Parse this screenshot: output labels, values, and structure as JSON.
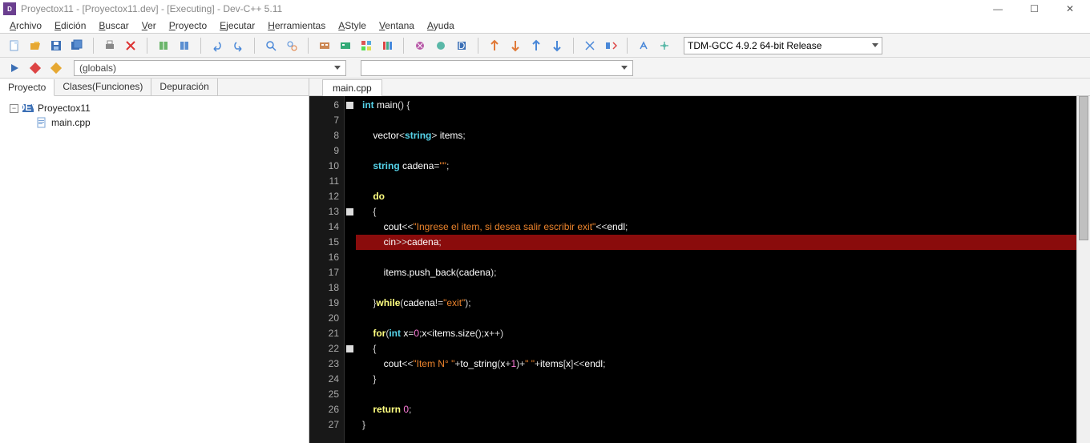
{
  "title": "Proyectox11 - [Proyectox11.dev] - [Executing] - Dev-C++ 5.11",
  "menu": [
    "Archivo",
    "Edición",
    "Buscar",
    "Ver",
    "Proyecto",
    "Ejecutar",
    "Herramientas",
    "AStyle",
    "Ventana",
    "Ayuda"
  ],
  "compiler": "TDM-GCC 4.9.2 64-bit Release",
  "globals": "(globals)",
  "left_tabs": [
    "Proyecto",
    "Clases(Funciones)",
    "Depuración"
  ],
  "project": {
    "name": "Proyectox11",
    "file": "main.cpp"
  },
  "file_tab": "main.cpp",
  "gutter_start": 6,
  "gutter_end": 27,
  "code_lines": [
    {
      "n": 6,
      "fold": true,
      "tokens": [
        {
          "t": "type",
          "v": "int"
        },
        {
          "t": "sp",
          "v": " "
        },
        {
          "t": "ident",
          "v": "main"
        },
        {
          "t": "punc",
          "v": "() {"
        }
      ]
    },
    {
      "n": 7,
      "tokens": []
    },
    {
      "n": 8,
      "tokens": [
        {
          "t": "sp",
          "v": "    "
        },
        {
          "t": "ident",
          "v": "vector"
        },
        {
          "t": "punc",
          "v": "<"
        },
        {
          "t": "type",
          "v": "string"
        },
        {
          "t": "punc",
          "v": "> "
        },
        {
          "t": "ident",
          "v": "items"
        },
        {
          "t": "punc",
          "v": ";"
        }
      ]
    },
    {
      "n": 9,
      "tokens": []
    },
    {
      "n": 10,
      "tokens": [
        {
          "t": "sp",
          "v": "    "
        },
        {
          "t": "type",
          "v": "string"
        },
        {
          "t": "sp",
          "v": " "
        },
        {
          "t": "ident",
          "v": "cadena"
        },
        {
          "t": "punc",
          "v": "="
        },
        {
          "t": "str",
          "v": "\"\""
        },
        {
          "t": "punc",
          "v": ";"
        }
      ]
    },
    {
      "n": 11,
      "tokens": []
    },
    {
      "n": 12,
      "tokens": [
        {
          "t": "sp",
          "v": "    "
        },
        {
          "t": "kw",
          "v": "do"
        }
      ]
    },
    {
      "n": 13,
      "fold": true,
      "tokens": [
        {
          "t": "sp",
          "v": "    "
        },
        {
          "t": "punc",
          "v": "{"
        }
      ]
    },
    {
      "n": 14,
      "tokens": [
        {
          "t": "sp",
          "v": "        "
        },
        {
          "t": "ident",
          "v": "cout"
        },
        {
          "t": "punc",
          "v": "<<"
        },
        {
          "t": "str",
          "v": "\"Ingrese el item, si desea salir escribir exit\""
        },
        {
          "t": "punc",
          "v": "<<"
        },
        {
          "t": "ident",
          "v": "endl"
        },
        {
          "t": "punc",
          "v": ";"
        }
      ]
    },
    {
      "n": 15,
      "hl": true,
      "tokens": [
        {
          "t": "sp",
          "v": "        "
        },
        {
          "t": "ident",
          "v": "cin"
        },
        {
          "t": "punc",
          "v": ">>"
        },
        {
          "t": "ident",
          "v": "cadena"
        },
        {
          "t": "punc",
          "v": ";"
        }
      ]
    },
    {
      "n": 16,
      "tokens": []
    },
    {
      "n": 17,
      "tokens": [
        {
          "t": "sp",
          "v": "        "
        },
        {
          "t": "ident",
          "v": "items.push_back"
        },
        {
          "t": "punc",
          "v": "("
        },
        {
          "t": "ident",
          "v": "cadena"
        },
        {
          "t": "punc",
          "v": ");"
        }
      ]
    },
    {
      "n": 18,
      "tokens": []
    },
    {
      "n": 19,
      "tokens": [
        {
          "t": "sp",
          "v": "    "
        },
        {
          "t": "punc",
          "v": "}"
        },
        {
          "t": "kw",
          "v": "while"
        },
        {
          "t": "punc",
          "v": "("
        },
        {
          "t": "ident",
          "v": "cadena"
        },
        {
          "t": "punc",
          "v": "!="
        },
        {
          "t": "str",
          "v": "\"exit\""
        },
        {
          "t": "punc",
          "v": ");"
        }
      ]
    },
    {
      "n": 20,
      "tokens": []
    },
    {
      "n": 21,
      "tokens": [
        {
          "t": "sp",
          "v": "    "
        },
        {
          "t": "kw",
          "v": "for"
        },
        {
          "t": "punc",
          "v": "("
        },
        {
          "t": "type",
          "v": "int"
        },
        {
          "t": "sp",
          "v": " "
        },
        {
          "t": "ident",
          "v": "x"
        },
        {
          "t": "punc",
          "v": "="
        },
        {
          "t": "num",
          "v": "0"
        },
        {
          "t": "punc",
          "v": ";"
        },
        {
          "t": "ident",
          "v": "x"
        },
        {
          "t": "punc",
          "v": "<"
        },
        {
          "t": "ident",
          "v": "items.size"
        },
        {
          "t": "punc",
          "v": "();"
        },
        {
          "t": "ident",
          "v": "x"
        },
        {
          "t": "punc",
          "v": "++)"
        }
      ]
    },
    {
      "n": 22,
      "fold": true,
      "tokens": [
        {
          "t": "sp",
          "v": "    "
        },
        {
          "t": "punc",
          "v": "{"
        }
      ]
    },
    {
      "n": 23,
      "tokens": [
        {
          "t": "sp",
          "v": "        "
        },
        {
          "t": "ident",
          "v": "cout"
        },
        {
          "t": "punc",
          "v": "<<"
        },
        {
          "t": "str",
          "v": "\"Item N° \""
        },
        {
          "t": "punc",
          "v": "+"
        },
        {
          "t": "ident",
          "v": "to_string"
        },
        {
          "t": "punc",
          "v": "("
        },
        {
          "t": "ident",
          "v": "x"
        },
        {
          "t": "punc",
          "v": "+"
        },
        {
          "t": "num",
          "v": "1"
        },
        {
          "t": "punc",
          "v": ")+"
        },
        {
          "t": "str",
          "v": "\" \""
        },
        {
          "t": "punc",
          "v": "+"
        },
        {
          "t": "ident",
          "v": "items"
        },
        {
          "t": "punc",
          "v": "["
        },
        {
          "t": "ident",
          "v": "x"
        },
        {
          "t": "punc",
          "v": "]<<"
        },
        {
          "t": "ident",
          "v": "endl"
        },
        {
          "t": "punc",
          "v": ";"
        }
      ]
    },
    {
      "n": 24,
      "tokens": [
        {
          "t": "sp",
          "v": "    "
        },
        {
          "t": "punc",
          "v": "}"
        }
      ]
    },
    {
      "n": 25,
      "tokens": []
    },
    {
      "n": 26,
      "tokens": [
        {
          "t": "sp",
          "v": "    "
        },
        {
          "t": "kw",
          "v": "return"
        },
        {
          "t": "sp",
          "v": " "
        },
        {
          "t": "num",
          "v": "0"
        },
        {
          "t": "punc",
          "v": ";"
        }
      ]
    },
    {
      "n": 27,
      "tokens": [
        {
          "t": "punc",
          "v": "}"
        }
      ]
    }
  ]
}
